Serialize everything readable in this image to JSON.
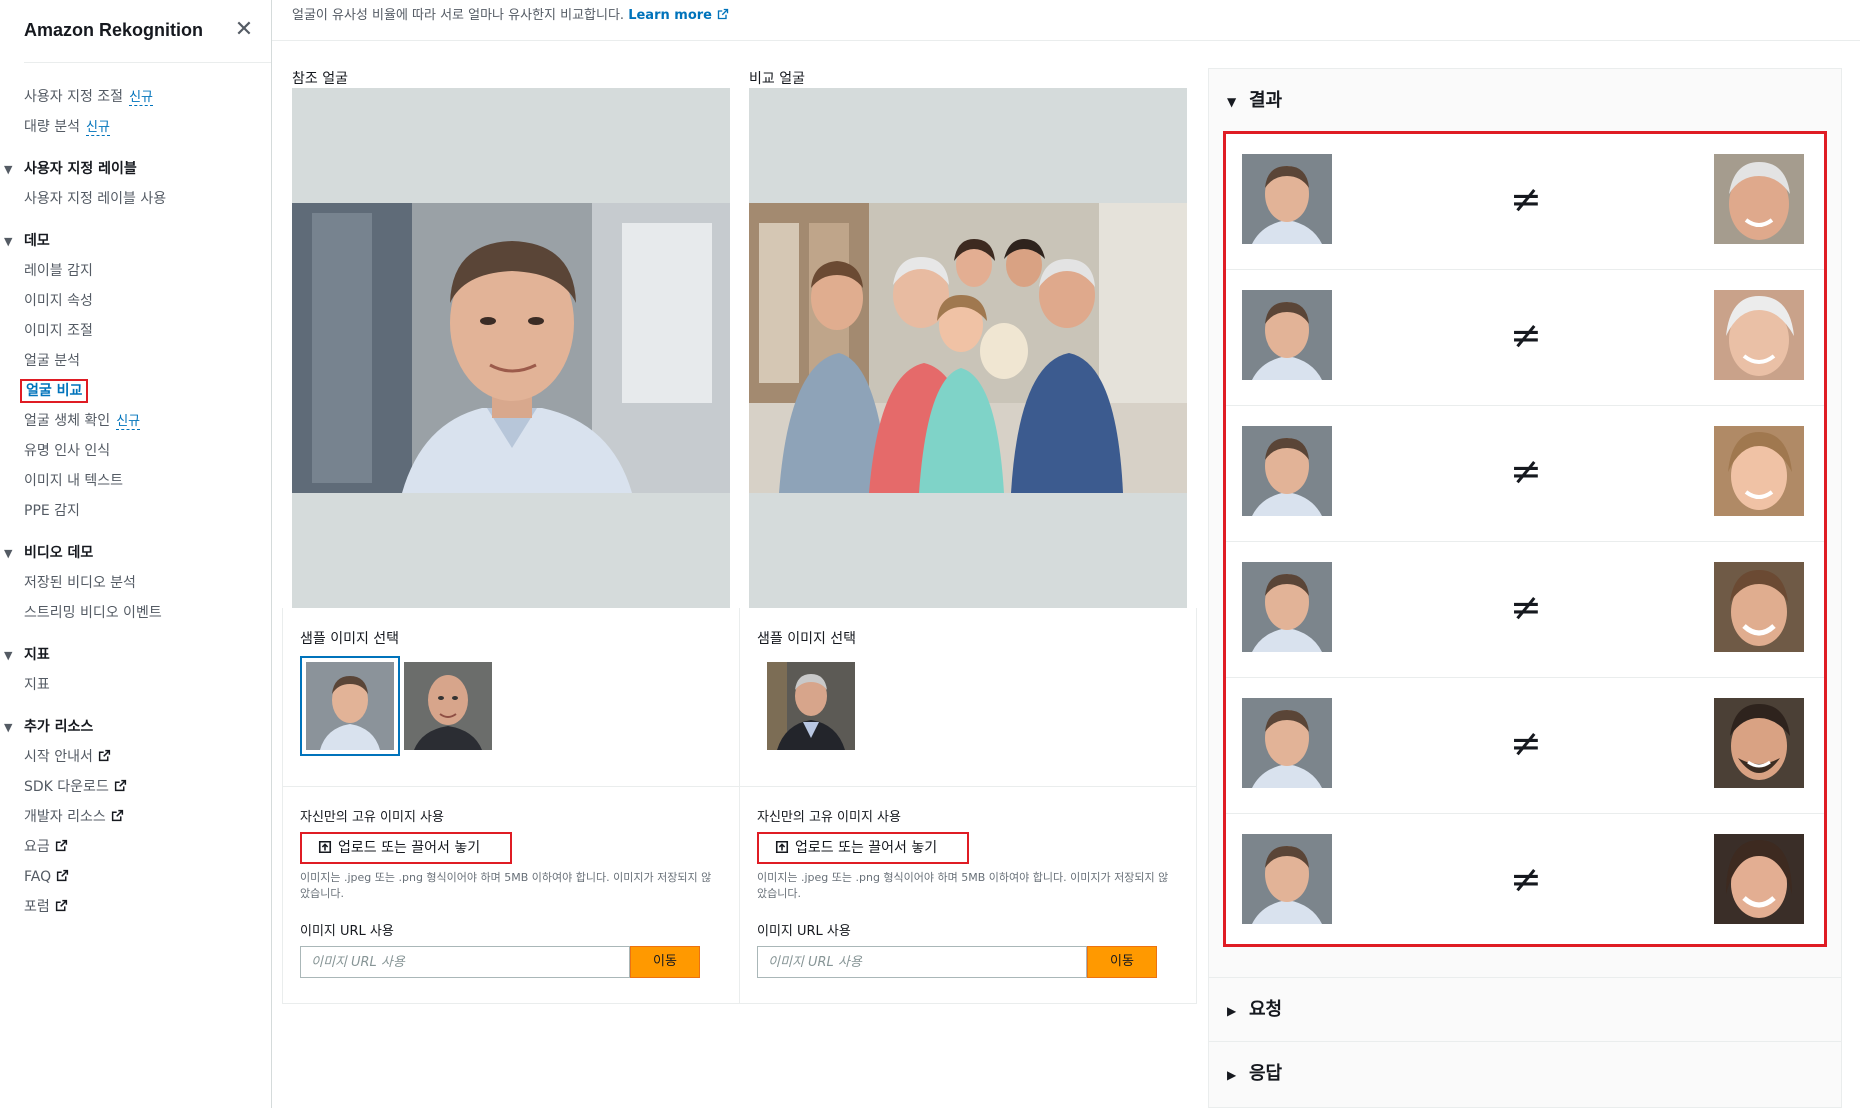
{
  "app": {
    "title": "Amazon Rekognition",
    "close_icon": "close-icon"
  },
  "nav": {
    "custom_moderation": "사용자 지정 조절",
    "bulk_analysis": "대량 분석",
    "new_badge": "신규",
    "sec_custom_labels": "사용자 지정 레이블",
    "use_custom_labels": "사용자 지정 레이블 사용",
    "sec_demos": "데모",
    "label_detection": "레이블 감지",
    "image_properties": "이미지 속성",
    "image_moderation": "이미지 조절",
    "facial_analysis": "얼굴 분석",
    "face_comparison": "얼굴 비교",
    "face_liveness": "얼굴 생체 확인",
    "celebrity_recognition": "유명 인사 인식",
    "text_in_image": "이미지 내 텍스트",
    "ppe_detection": "PPE 감지",
    "sec_video_demos": "비디오 데모",
    "stored_video": "저장된 비디오 분석",
    "streaming_video": "스트리밍 비디오 이벤트",
    "sec_metrics": "지표",
    "metrics": "지표",
    "sec_additional": "추가 리소스",
    "getting_started": "시작 안내서",
    "sdk_download": "SDK 다운로드",
    "dev_resources": "개발자 리소스",
    "pricing": "요금",
    "faq": "FAQ",
    "forum": "포럼"
  },
  "header": {
    "description": "얼굴이 유사성 비율에 따라 서로 얼마나 유사한지 비교합니다.",
    "learn_more": "Learn more"
  },
  "reference": {
    "title": "참조 얼굴",
    "sample_title": "샘플 이미지 선택",
    "own_title": "자신만의 고유 이미지 사용",
    "upload_label": "업로드 또는 끌어서 놓기",
    "hint": "이미지는 .jpeg 또는 .png 형식이어야 하며 5MB 이하여야 합니다. 이미지가 저장되지 않았습니다.",
    "url_title": "이미지 URL 사용",
    "url_placeholder": "이미지 URL 사용",
    "go_label": "이동"
  },
  "comparison": {
    "title": "비교 얼굴",
    "sample_title": "샘플 이미지 선택",
    "own_title": "자신만의 고유 이미지 사용",
    "upload_label": "업로드 또는 끌어서 놓기",
    "hint": "이미지는 .jpeg 또는 .png 형식이어야 하며 5MB 이하여야 합니다. 이미지가 저장되지 않았습니다.",
    "url_title": "이미지 URL 사용",
    "url_placeholder": "이미지 URL 사용",
    "go_label": "이동"
  },
  "results": {
    "title": "결과",
    "not_equal_symbol": "≠",
    "match_count": 6,
    "request": "요청",
    "response": "응답"
  },
  "colors": {
    "accent_blue": "#0073bb",
    "highlight_red": "#df1c24",
    "go_orange": "#ff9900"
  }
}
